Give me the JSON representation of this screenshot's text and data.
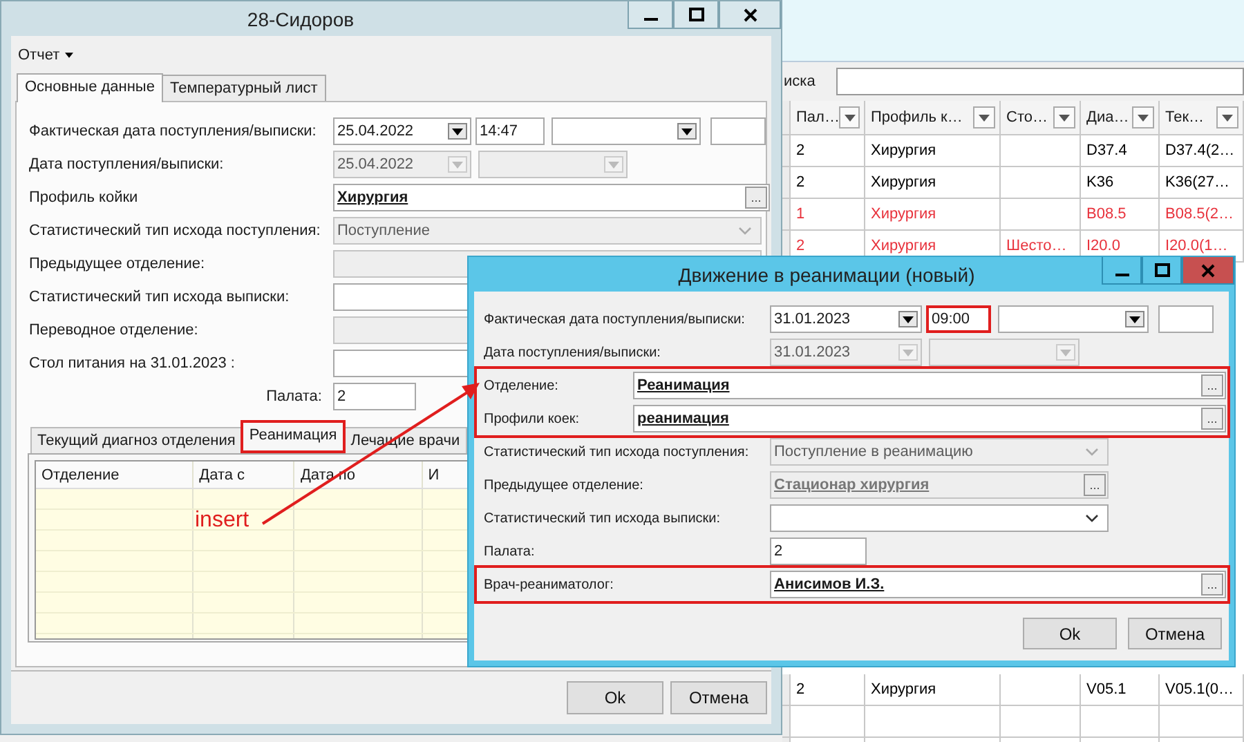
{
  "background_app": {
    "search_label": "иска",
    "grid": {
      "columns": [
        "Пал…",
        "Профиль к…",
        "Сто…",
        "Диа…",
        "Тек…"
      ],
      "rows": [
        {
          "cells": [
            "2",
            "Хирургия",
            null,
            "D37.4",
            "D37.4(2…"
          ],
          "color": "#000000"
        },
        {
          "cells": [
            "2",
            "Хирургия",
            null,
            "K36",
            "K36(27…"
          ],
          "color": "#000000"
        },
        {
          "cells": [
            "1",
            "Хирургия",
            null,
            "B08.5",
            "B08.5(2…"
          ],
          "color": "#e8323c"
        },
        {
          "cells": [
            "2",
            "Хирургия",
            "Шесто…",
            "I20.0",
            "I20.0(1…"
          ],
          "color": "#e8323c"
        }
      ],
      "rows_below": [
        {
          "cells": [
            "2",
            "Хирургия",
            null,
            "V05.1",
            "V05.1(0…"
          ],
          "color": "#000000"
        }
      ]
    }
  },
  "main_window": {
    "title": "28-Сидоров",
    "menu": "Отчет",
    "tabs": [
      {
        "label": "Основные данные",
        "selected": true
      },
      {
        "label": "Температурный лист",
        "selected": false
      }
    ],
    "form": [
      {
        "kind": "datetime",
        "label": "Фактическая дата поступления/выписки:",
        "date": "25.04.2022",
        "time": "14:47",
        "time_highlighted": false,
        "disabled": false
      },
      {
        "kind": "datetime",
        "label": "Дата поступления/выписки:",
        "date": "25.04.2022",
        "disabled": true
      },
      {
        "kind": "lookup",
        "label": "Профиль койки",
        "value": "Хирургия",
        "button": "...",
        "disabled": false
      },
      {
        "kind": "combo",
        "label": "Статистический тип исхода поступления:",
        "value": "Поступление",
        "disabled": true
      },
      {
        "kind": "text",
        "label": "Предыдущее отделение:",
        "disabled": true
      },
      {
        "kind": "text",
        "label": "Статистический тип исхода выписки:",
        "disabled": false
      },
      {
        "kind": "text",
        "label": "Переводное отделение:",
        "disabled": true
      },
      {
        "kind": "text",
        "label": "Стол питания на 31.01.2023 :",
        "disabled": false
      },
      {
        "kind": "short",
        "label": "Палата:",
        "value": "2",
        "disabled": false
      }
    ],
    "subtabs": [
      {
        "label": "Текущий диагноз отделения",
        "selected": false,
        "highlighted": false
      },
      {
        "label": "Реанимация",
        "selected": true,
        "highlighted": true
      },
      {
        "label": "Лечащие врачи",
        "selected": false,
        "highlighted": false
      }
    ],
    "subgrid": {
      "columns": [
        "Отделение",
        "Дата с",
        "Дата по",
        "И"
      ]
    },
    "buttons": [
      "Ok",
      "Отмена"
    ]
  },
  "annotation": {
    "label": "insert"
  },
  "dialog": {
    "title": "Движение в реанимации (новый)",
    "form": [
      {
        "kind": "datetime",
        "label": "Фактическая дата поступления/выписки:",
        "date": "31.01.2023",
        "time": "09:00",
        "time_highlighted": true,
        "disabled": false
      },
      {
        "kind": "datetime",
        "label": "Дата поступления/выписки:",
        "date": "31.01.2023",
        "disabled": true
      },
      {
        "kind": "group",
        "highlighted": true,
        "rows": [
          {
            "kind": "wide_lookup",
            "label": "Отделение:",
            "value": "Реанимация",
            "button": "...",
            "disabled": false
          },
          {
            "kind": "wide_lookup",
            "label": "Профили коек:",
            "value": "реанимация",
            "button": "...",
            "disabled": false
          }
        ]
      },
      {
        "kind": "combo",
        "label": "Статистический тип исхода поступления:",
        "value": "Поступление в реанимацию",
        "disabled": true
      },
      {
        "kind": "lookup",
        "label": "Предыдущее отделение:",
        "value": "Стационар  хирургия",
        "button": "...",
        "disabled": true
      },
      {
        "kind": "combo",
        "label": "Статистический тип исхода выписки:",
        "disabled": false
      },
      {
        "kind": "short",
        "label": "Палата:",
        "value": "2",
        "disabled": false
      },
      {
        "kind": "group",
        "highlighted": true,
        "rows": [
          {
            "kind": "lookup",
            "label": "Врач-реаниматолог:",
            "value": "Анисимов И.З.",
            "button": "...",
            "disabled": false
          }
        ]
      }
    ],
    "buttons": [
      "Ok",
      "Отмена"
    ]
  }
}
